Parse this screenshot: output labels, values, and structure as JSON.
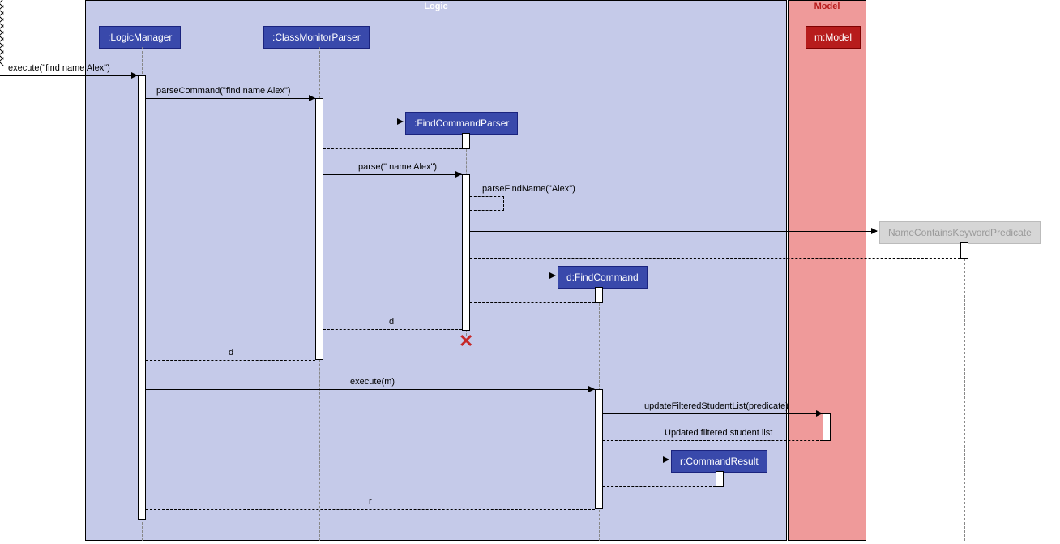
{
  "frames": {
    "logic": "Logic",
    "model": "Model"
  },
  "participants": {
    "logicManager": ":LogicManager",
    "classMonitorParser": ":ClassMonitorParser",
    "findCommandParser": ":FindCommandParser",
    "findCommand": "d:FindCommand",
    "commandResult": "r:CommandResult",
    "mModel": "m:Model",
    "namePredicate": "NameContainsKeywordPredicate"
  },
  "messages": {
    "execute1": "execute(\"find name Alex\")",
    "parseCommand": "parseCommand(\"find name Alex\")",
    "parse": "parse(\" name Alex\")",
    "parseFindName": "parseFindName(\"Alex\")",
    "d1": "d",
    "d2": "d",
    "executeM": "execute(m)",
    "updateFiltered": "updateFilteredStudentList(predicate)",
    "updatedList": "Updated filtered student list",
    "r": "r"
  }
}
